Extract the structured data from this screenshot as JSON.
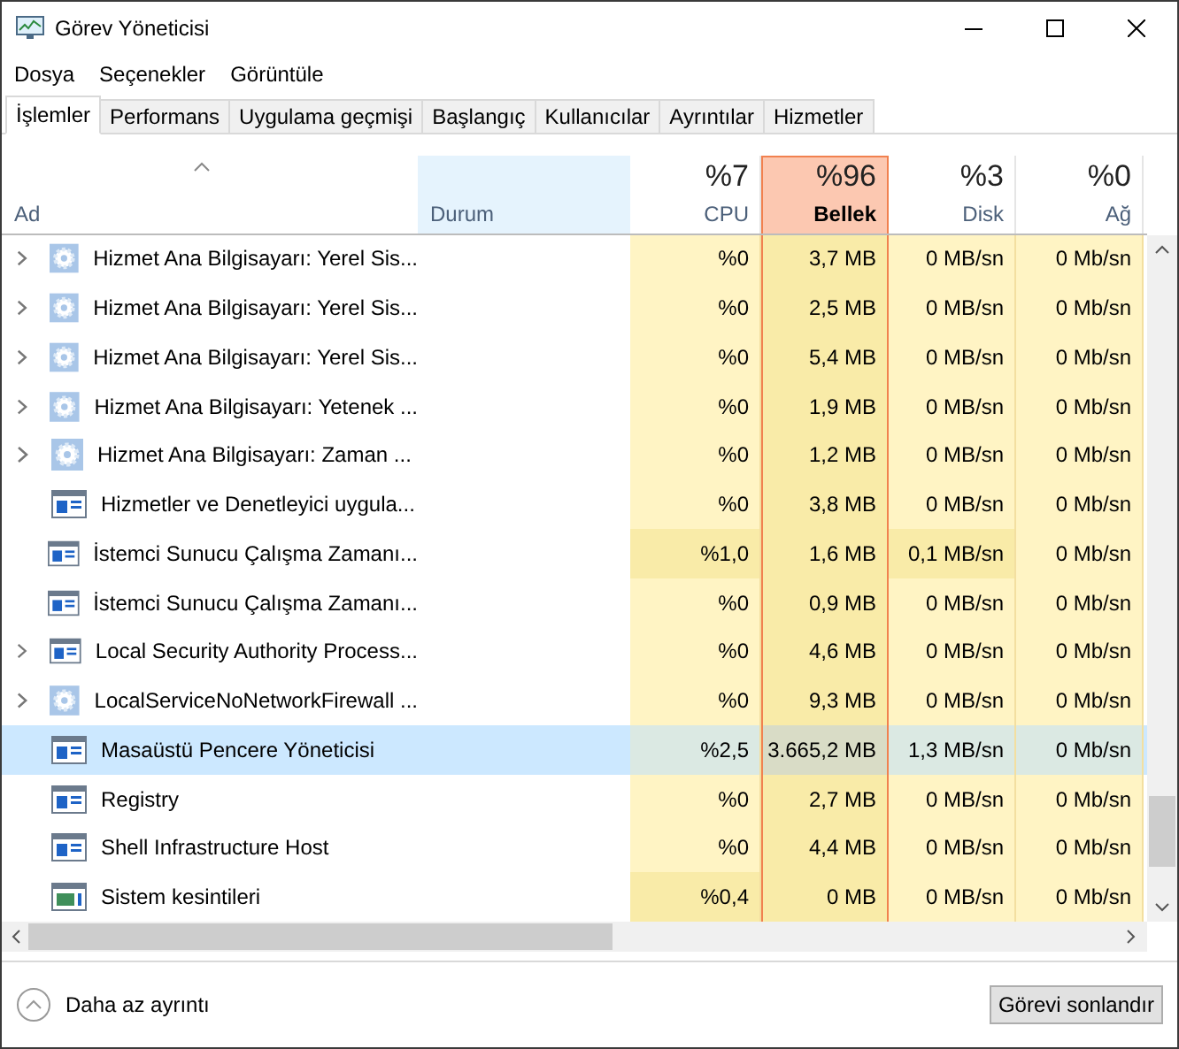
{
  "window": {
    "title": "Görev Yöneticisi"
  },
  "menu": [
    "Dosya",
    "Seçenekler",
    "Görüntüle"
  ],
  "tabs": [
    {
      "label": "İşlemler",
      "selected": true
    },
    {
      "label": "Performans",
      "selected": false
    },
    {
      "label": "Uygulama geçmişi",
      "selected": false
    },
    {
      "label": "Başlangıç",
      "selected": false
    },
    {
      "label": "Kullanıcılar",
      "selected": false
    },
    {
      "label": "Ayrıntılar",
      "selected": false
    },
    {
      "label": "Hizmetler",
      "selected": false
    }
  ],
  "columns": [
    {
      "label": "Ad",
      "selected": false,
      "hovered": false
    },
    {
      "label": "Durum",
      "selected": false,
      "hovered": true
    },
    {
      "label": "CPU",
      "total": "%7",
      "selected": false,
      "hovered": false
    },
    {
      "label": "Bellek",
      "total": "%96",
      "selected": true,
      "hovered": false
    },
    {
      "label": "Disk",
      "total": "%3",
      "selected": false,
      "hovered": false
    },
    {
      "label": "Ağ",
      "total": "%0",
      "selected": false,
      "hovered": false
    }
  ],
  "rows": [
    {
      "name": "Hizmet Ana Bilgisayarı: Yerel Sis...",
      "kind": "service",
      "expandable": true,
      "selected": false,
      "cells": [
        {
          "text": "%0",
          "hot": false
        },
        {
          "text": "3,7 MB",
          "hot": false
        },
        {
          "text": "0 MB/sn",
          "hot": false
        },
        {
          "text": "0 Mb/sn",
          "hot": false
        }
      ]
    },
    {
      "name": "Hizmet Ana Bilgisayarı: Yerel Sis...",
      "kind": "service",
      "expandable": true,
      "selected": false,
      "cells": [
        {
          "text": "%0",
          "hot": false
        },
        {
          "text": "2,5 MB",
          "hot": false
        },
        {
          "text": "0 MB/sn",
          "hot": false
        },
        {
          "text": "0 Mb/sn",
          "hot": false
        }
      ]
    },
    {
      "name": "Hizmet Ana Bilgisayarı: Yerel Sis...",
      "kind": "service",
      "expandable": true,
      "selected": false,
      "cells": [
        {
          "text": "%0",
          "hot": false
        },
        {
          "text": "5,4 MB",
          "hot": false
        },
        {
          "text": "0 MB/sn",
          "hot": false
        },
        {
          "text": "0 Mb/sn",
          "hot": false
        }
      ]
    },
    {
      "name": "Hizmet Ana Bilgisayarı: Yetenek ...",
      "kind": "service",
      "expandable": true,
      "selected": false,
      "cells": [
        {
          "text": "%0",
          "hot": false
        },
        {
          "text": "1,9 MB",
          "hot": false
        },
        {
          "text": "0 MB/sn",
          "hot": false
        },
        {
          "text": "0 Mb/sn",
          "hot": false
        }
      ]
    },
    {
      "name": "Hizmet Ana Bilgisayarı: Zaman ...",
      "kind": "service",
      "expandable": true,
      "selected": false,
      "cells": [
        {
          "text": "%0",
          "hot": false
        },
        {
          "text": "1,2 MB",
          "hot": false
        },
        {
          "text": "0 MB/sn",
          "hot": false
        },
        {
          "text": "0 Mb/sn",
          "hot": false
        }
      ]
    },
    {
      "name": "Hizmetler ve Denetleyici uygula...",
      "kind": "process",
      "expandable": false,
      "selected": false,
      "cells": [
        {
          "text": "%0",
          "hot": false
        },
        {
          "text": "3,8 MB",
          "hot": false
        },
        {
          "text": "0 MB/sn",
          "hot": false
        },
        {
          "text": "0 Mb/sn",
          "hot": false
        }
      ]
    },
    {
      "name": "İstemci Sunucu Çalışma Zamanı...",
      "kind": "process",
      "expandable": false,
      "selected": false,
      "cells": [
        {
          "text": "%1,0",
          "hot": true
        },
        {
          "text": "1,6 MB",
          "hot": false
        },
        {
          "text": "0,1 MB/sn",
          "hot": true
        },
        {
          "text": "0 Mb/sn",
          "hot": false
        }
      ]
    },
    {
      "name": "İstemci Sunucu Çalışma Zamanı...",
      "kind": "process",
      "expandable": false,
      "selected": false,
      "cells": [
        {
          "text": "%0",
          "hot": false
        },
        {
          "text": "0,9 MB",
          "hot": false
        },
        {
          "text": "0 MB/sn",
          "hot": false
        },
        {
          "text": "0 Mb/sn",
          "hot": false
        }
      ]
    },
    {
      "name": "Local Security Authority Process...",
      "kind": "process",
      "expandable": true,
      "selected": false,
      "cells": [
        {
          "text": "%0",
          "hot": false
        },
        {
          "text": "4,6 MB",
          "hot": false
        },
        {
          "text": "0 MB/sn",
          "hot": false
        },
        {
          "text": "0 Mb/sn",
          "hot": false
        }
      ]
    },
    {
      "name": "LocalServiceNoNetworkFirewall ...",
      "kind": "service",
      "expandable": true,
      "selected": false,
      "cells": [
        {
          "text": "%0",
          "hot": false
        },
        {
          "text": "9,3 MB",
          "hot": false
        },
        {
          "text": "0 MB/sn",
          "hot": false
        },
        {
          "text": "0 Mb/sn",
          "hot": false
        }
      ]
    },
    {
      "name": "Masaüstü Pencere Yöneticisi",
      "kind": "process",
      "expandable": false,
      "selected": true,
      "cells": [
        {
          "text": "%2,5",
          "hot": false
        },
        {
          "text": "3.665,2 MB",
          "hot": true
        },
        {
          "text": "1,3 MB/sn",
          "hot": false
        },
        {
          "text": "0 Mb/sn",
          "hot": false
        }
      ]
    },
    {
      "name": "Registry",
      "kind": "process",
      "expandable": false,
      "selected": false,
      "cells": [
        {
          "text": "%0",
          "hot": false
        },
        {
          "text": "2,7 MB",
          "hot": false
        },
        {
          "text": "0 MB/sn",
          "hot": false
        },
        {
          "text": "0 Mb/sn",
          "hot": false
        }
      ]
    },
    {
      "name": "Shell Infrastructure Host",
      "kind": "process",
      "expandable": false,
      "selected": false,
      "cells": [
        {
          "text": "%0",
          "hot": false
        },
        {
          "text": "4,4 MB",
          "hot": false
        },
        {
          "text": "0 MB/sn",
          "hot": false
        },
        {
          "text": "0 Mb/sn",
          "hot": false
        }
      ]
    },
    {
      "name": "Sistem kesintileri",
      "kind": "system",
      "expandable": false,
      "selected": false,
      "cells": [
        {
          "text": "%0,4",
          "hot": true
        },
        {
          "text": "0 MB",
          "hot": false
        },
        {
          "text": "0 MB/sn",
          "hot": false
        },
        {
          "text": "0 Mb/sn",
          "hot": false
        }
      ]
    }
  ],
  "footer": {
    "toggle": "Daha az ayrıntı",
    "button": "Görevi sonlandır"
  }
}
